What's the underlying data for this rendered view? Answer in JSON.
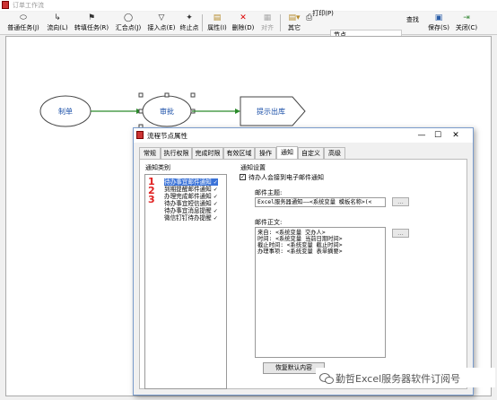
{
  "window": {
    "title": "订单工作流"
  },
  "toolbar": {
    "items": [
      {
        "label": "普通任务(J)",
        "icon": "ellipse-icon"
      },
      {
        "label": "流向(L)",
        "icon": "flow-arrow-icon"
      },
      {
        "label": "转填任务(R)",
        "icon": "flag-icon"
      },
      {
        "label": "汇合点(J)",
        "icon": "join-circle-icon"
      },
      {
        "label": "接入点(E)",
        "icon": "triangle-icon"
      },
      {
        "label": "终止点",
        "icon": "stop-icon"
      },
      {
        "label": "属性(I)",
        "icon": "properties-icon"
      },
      {
        "label": "删除(D)",
        "icon": "delete-icon"
      },
      {
        "label": "对齐",
        "icon": "align-icon"
      },
      {
        "label": "其它",
        "icon": "other-icon"
      },
      {
        "label": "打印(P)",
        "icon": "print-icon"
      },
      {
        "label": "保存(S)",
        "icon": "save-icon"
      },
      {
        "label": "关闭(C)",
        "icon": "close-icon"
      }
    ],
    "search_value": "节点",
    "find_label": "查找"
  },
  "flow": {
    "nodes": [
      "制单",
      "审批",
      "提示出库"
    ]
  },
  "dialog": {
    "title": "流程节点属性",
    "controls": {
      "minimize": "—",
      "maximize": "☐",
      "close": "✕"
    },
    "tabs": [
      "常规",
      "执行权限",
      "完成时限",
      "有效区域",
      "操作",
      "通知",
      "自定义",
      "高级"
    ],
    "active_tab": "通知",
    "left_group_label": "通知类别",
    "notify_items": [
      {
        "label": "待办事宜邮件通知",
        "check": "✓",
        "num": "1"
      },
      {
        "label": "到期提醒邮件通知",
        "check": "✓",
        "num": "2"
      },
      {
        "label": "办理完成邮件通知",
        "check": "✓",
        "num": "3"
      },
      {
        "label": "待办事宜短信通知",
        "check": "✓",
        "num": ""
      },
      {
        "label": "待办事宜消息提醒",
        "check": "✓",
        "num": ""
      },
      {
        "label": "微信钉钉待办提醒",
        "check": "✓",
        "num": ""
      }
    ],
    "right_group_label": "通知设置",
    "checkbox_label": "待办人会接到电子邮件通知",
    "checkbox_mark": "✓",
    "subject_label": "邮件主题:",
    "subject_value": "Excel服务器通知——<系统变量 模板名称>(<",
    "body_label": "邮件正文:",
    "body_lines": [
      "来自: <系统变量 交办人>",
      "时间: <系统变量 当前日期时间>",
      "截止时间: <系统变量 截止时间>",
      "办理事项: <系统变量 表单摘要>"
    ],
    "more_button": "...",
    "restore_button": "恢复默认内容"
  },
  "watermark": {
    "text": "勤哲Excel服务器软件订阅号"
  }
}
